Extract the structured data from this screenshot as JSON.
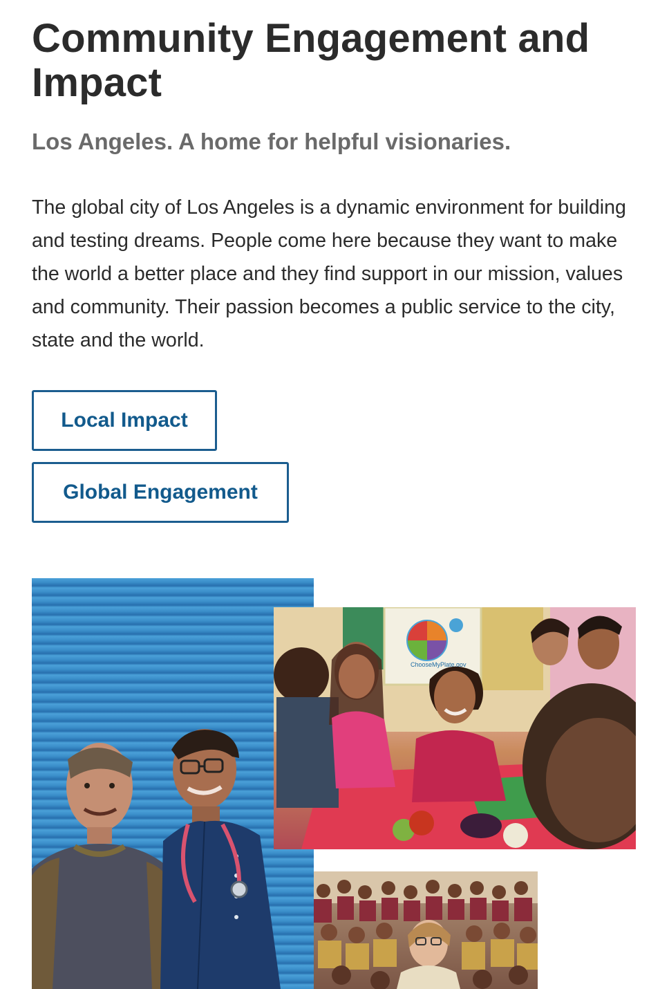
{
  "header": {
    "title": "Community Engagement and Impact",
    "subtitle": "Los Angeles. A home for helpful visionaries."
  },
  "intro": {
    "text": "The global city of Los Angeles is a dynamic environment for building and testing dreams. People come here because they want to make the world a better place and they find support in our mission, values and community. Their passion becomes a public service to the city, state and the world."
  },
  "buttons": {
    "local_impact": "Local Impact",
    "global_engagement": "Global Engagement"
  },
  "colors": {
    "heading": "#2b2b2b",
    "subtitle": "#6a6a6a",
    "button_border": "#1b5d8f",
    "button_text": "#125a8c"
  },
  "collage": {
    "poster_text": "ChooseMyPlate.gov"
  }
}
